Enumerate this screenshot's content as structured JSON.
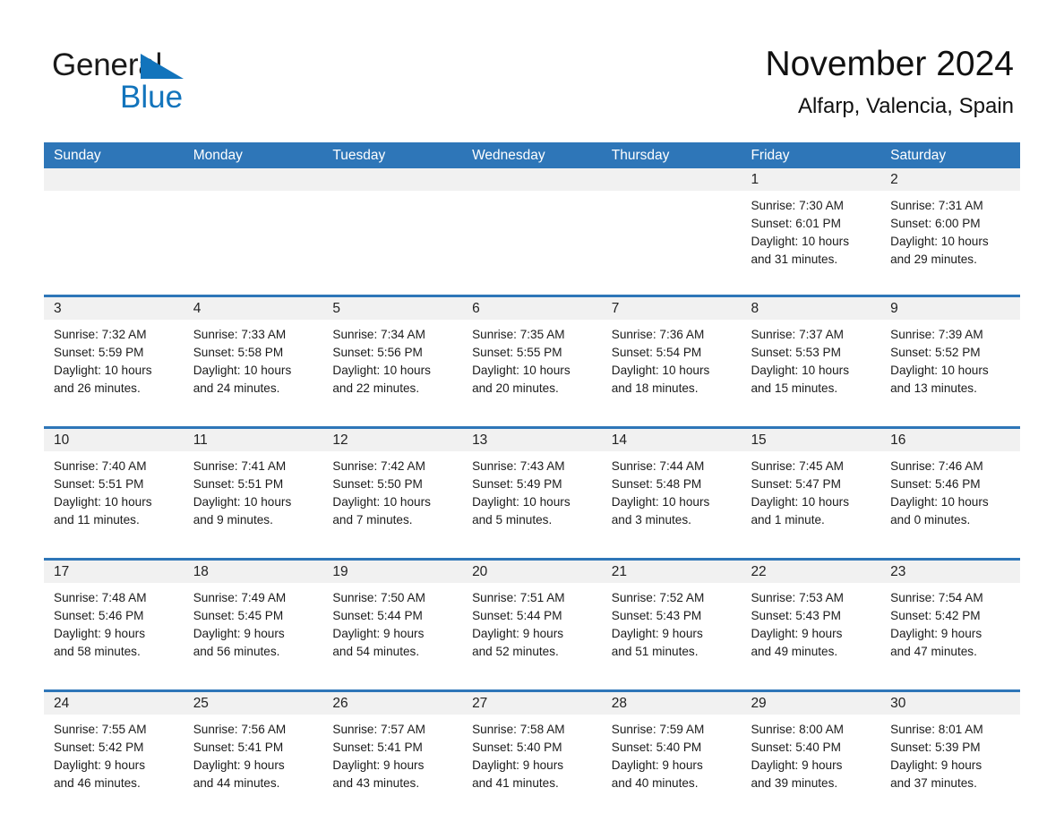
{
  "brand": {
    "word1": "General",
    "word2": "Blue",
    "triangle_icon": "triangle-icon",
    "color_dark": "#1a1a1a",
    "color_blue": "#1274bc"
  },
  "header": {
    "title": "November 2024",
    "subtitle": "Alfarp, Valencia, Spain"
  },
  "theme": {
    "header_blue": "#2e76b8",
    "row_rule_blue": "#2e76b8",
    "day_band_gray": "#f1f1f1",
    "cell_white": "#ffffff"
  },
  "calendar": {
    "weekday_headers": [
      "Sunday",
      "Monday",
      "Tuesday",
      "Wednesday",
      "Thursday",
      "Friday",
      "Saturday"
    ],
    "weeks": [
      [
        {
          "day": "",
          "empty": true,
          "lines": []
        },
        {
          "day": "",
          "empty": true,
          "lines": []
        },
        {
          "day": "",
          "empty": true,
          "lines": []
        },
        {
          "day": "",
          "empty": true,
          "lines": []
        },
        {
          "day": "",
          "empty": true,
          "lines": []
        },
        {
          "day": "1",
          "empty": false,
          "lines": [
            "Sunrise: 7:30 AM",
            "Sunset: 6:01 PM",
            "Daylight: 10 hours",
            "and 31 minutes."
          ]
        },
        {
          "day": "2",
          "empty": false,
          "lines": [
            "Sunrise: 7:31 AM",
            "Sunset: 6:00 PM",
            "Daylight: 10 hours",
            "and 29 minutes."
          ]
        }
      ],
      [
        {
          "day": "3",
          "empty": false,
          "lines": [
            "Sunrise: 7:32 AM",
            "Sunset: 5:59 PM",
            "Daylight: 10 hours",
            "and 26 minutes."
          ]
        },
        {
          "day": "4",
          "empty": false,
          "lines": [
            "Sunrise: 7:33 AM",
            "Sunset: 5:58 PM",
            "Daylight: 10 hours",
            "and 24 minutes."
          ]
        },
        {
          "day": "5",
          "empty": false,
          "lines": [
            "Sunrise: 7:34 AM",
            "Sunset: 5:56 PM",
            "Daylight: 10 hours",
            "and 22 minutes."
          ]
        },
        {
          "day": "6",
          "empty": false,
          "lines": [
            "Sunrise: 7:35 AM",
            "Sunset: 5:55 PM",
            "Daylight: 10 hours",
            "and 20 minutes."
          ]
        },
        {
          "day": "7",
          "empty": false,
          "lines": [
            "Sunrise: 7:36 AM",
            "Sunset: 5:54 PM",
            "Daylight: 10 hours",
            "and 18 minutes."
          ]
        },
        {
          "day": "8",
          "empty": false,
          "lines": [
            "Sunrise: 7:37 AM",
            "Sunset: 5:53 PM",
            "Daylight: 10 hours",
            "and 15 minutes."
          ]
        },
        {
          "day": "9",
          "empty": false,
          "lines": [
            "Sunrise: 7:39 AM",
            "Sunset: 5:52 PM",
            "Daylight: 10 hours",
            "and 13 minutes."
          ]
        }
      ],
      [
        {
          "day": "10",
          "empty": false,
          "lines": [
            "Sunrise: 7:40 AM",
            "Sunset: 5:51 PM",
            "Daylight: 10 hours",
            "and 11 minutes."
          ]
        },
        {
          "day": "11",
          "empty": false,
          "lines": [
            "Sunrise: 7:41 AM",
            "Sunset: 5:51 PM",
            "Daylight: 10 hours",
            "and 9 minutes."
          ]
        },
        {
          "day": "12",
          "empty": false,
          "lines": [
            "Sunrise: 7:42 AM",
            "Sunset: 5:50 PM",
            "Daylight: 10 hours",
            "and 7 minutes."
          ]
        },
        {
          "day": "13",
          "empty": false,
          "lines": [
            "Sunrise: 7:43 AM",
            "Sunset: 5:49 PM",
            "Daylight: 10 hours",
            "and 5 minutes."
          ]
        },
        {
          "day": "14",
          "empty": false,
          "lines": [
            "Sunrise: 7:44 AM",
            "Sunset: 5:48 PM",
            "Daylight: 10 hours",
            "and 3 minutes."
          ]
        },
        {
          "day": "15",
          "empty": false,
          "lines": [
            "Sunrise: 7:45 AM",
            "Sunset: 5:47 PM",
            "Daylight: 10 hours",
            "and 1 minute."
          ]
        },
        {
          "day": "16",
          "empty": false,
          "lines": [
            "Sunrise: 7:46 AM",
            "Sunset: 5:46 PM",
            "Daylight: 10 hours",
            "and 0 minutes."
          ]
        }
      ],
      [
        {
          "day": "17",
          "empty": false,
          "lines": [
            "Sunrise: 7:48 AM",
            "Sunset: 5:46 PM",
            "Daylight: 9 hours",
            "and 58 minutes."
          ]
        },
        {
          "day": "18",
          "empty": false,
          "lines": [
            "Sunrise: 7:49 AM",
            "Sunset: 5:45 PM",
            "Daylight: 9 hours",
            "and 56 minutes."
          ]
        },
        {
          "day": "19",
          "empty": false,
          "lines": [
            "Sunrise: 7:50 AM",
            "Sunset: 5:44 PM",
            "Daylight: 9 hours",
            "and 54 minutes."
          ]
        },
        {
          "day": "20",
          "empty": false,
          "lines": [
            "Sunrise: 7:51 AM",
            "Sunset: 5:44 PM",
            "Daylight: 9 hours",
            "and 52 minutes."
          ]
        },
        {
          "day": "21",
          "empty": false,
          "lines": [
            "Sunrise: 7:52 AM",
            "Sunset: 5:43 PM",
            "Daylight: 9 hours",
            "and 51 minutes."
          ]
        },
        {
          "day": "22",
          "empty": false,
          "lines": [
            "Sunrise: 7:53 AM",
            "Sunset: 5:43 PM",
            "Daylight: 9 hours",
            "and 49 minutes."
          ]
        },
        {
          "day": "23",
          "empty": false,
          "lines": [
            "Sunrise: 7:54 AM",
            "Sunset: 5:42 PM",
            "Daylight: 9 hours",
            "and 47 minutes."
          ]
        }
      ],
      [
        {
          "day": "24",
          "empty": false,
          "lines": [
            "Sunrise: 7:55 AM",
            "Sunset: 5:42 PM",
            "Daylight: 9 hours",
            "and 46 minutes."
          ]
        },
        {
          "day": "25",
          "empty": false,
          "lines": [
            "Sunrise: 7:56 AM",
            "Sunset: 5:41 PM",
            "Daylight: 9 hours",
            "and 44 minutes."
          ]
        },
        {
          "day": "26",
          "empty": false,
          "lines": [
            "Sunrise: 7:57 AM",
            "Sunset: 5:41 PM",
            "Daylight: 9 hours",
            "and 43 minutes."
          ]
        },
        {
          "day": "27",
          "empty": false,
          "lines": [
            "Sunrise: 7:58 AM",
            "Sunset: 5:40 PM",
            "Daylight: 9 hours",
            "and 41 minutes."
          ]
        },
        {
          "day": "28",
          "empty": false,
          "lines": [
            "Sunrise: 7:59 AM",
            "Sunset: 5:40 PM",
            "Daylight: 9 hours",
            "and 40 minutes."
          ]
        },
        {
          "day": "29",
          "empty": false,
          "lines": [
            "Sunrise: 8:00 AM",
            "Sunset: 5:40 PM",
            "Daylight: 9 hours",
            "and 39 minutes."
          ]
        },
        {
          "day": "30",
          "empty": false,
          "lines": [
            "Sunrise: 8:01 AM",
            "Sunset: 5:39 PM",
            "Daylight: 9 hours",
            "and 37 minutes."
          ]
        }
      ]
    ]
  }
}
